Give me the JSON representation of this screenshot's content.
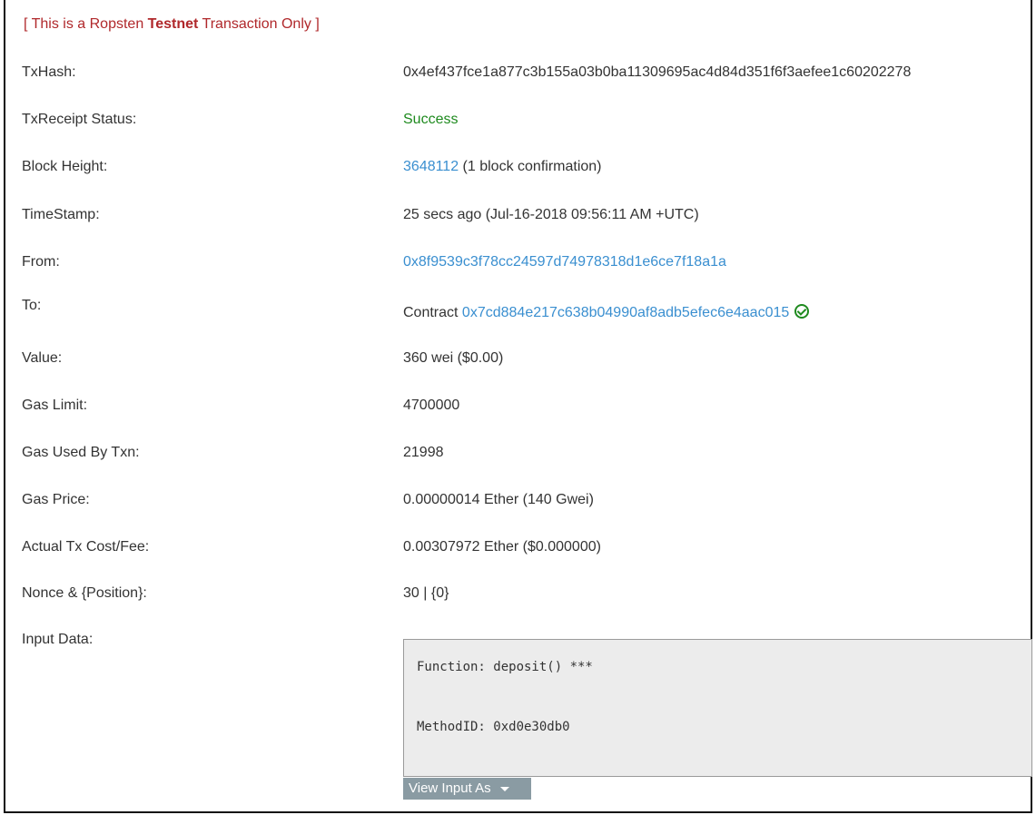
{
  "notice": {
    "prefix": "[ This is a Ropsten ",
    "bold": "Testnet",
    "suffix": " Transaction Only ]"
  },
  "txhash": {
    "label": "TxHash:",
    "value": "0x4ef437fce1a877c3b155a03b0ba11309695ac4d84d351f6f3aefee1c60202278"
  },
  "status": {
    "label": "TxReceipt Status:",
    "value": "Success"
  },
  "block": {
    "label": "Block Height:",
    "number": "3648112",
    "confirm": " (1 block confirmation)"
  },
  "timestamp": {
    "label": "TimeStamp:",
    "value": "25 secs ago (Jul-16-2018 09:56:11 AM +UTC)"
  },
  "from": {
    "label": "From:",
    "value": "0x8f9539c3f78cc24597d74978318d1e6ce7f18a1a"
  },
  "to": {
    "label": "To:",
    "prefix": "Contract ",
    "address": "0x7cd884e217c638b04990af8adb5efec6e4aac015"
  },
  "value": {
    "label": "Value:",
    "value": "360 wei ($0.00)"
  },
  "gas_limit": {
    "label": "Gas Limit:",
    "value": "4700000"
  },
  "gas_used": {
    "label": "Gas Used By Txn:",
    "value": "21998"
  },
  "gas_price": {
    "label": "Gas Price:",
    "value": "0.00000014 Ether (140 Gwei)"
  },
  "fee": {
    "label": "Actual Tx Cost/Fee:",
    "value": "0.00307972 Ether ($0.000000)"
  },
  "nonce": {
    "label": "Nonce & {Position}:",
    "value": "30 | {0}"
  },
  "input": {
    "label": "Input Data:",
    "function_line": "Function: deposit() ***",
    "method_line": "MethodID: 0xd0e30db0",
    "view_button": "View Input As"
  },
  "colors": {
    "notice": "#b0282b",
    "link": "#3a8fd0",
    "success": "#1e8a1e",
    "input_bg": "#ececec",
    "button_bg": "#8a9ba3"
  }
}
